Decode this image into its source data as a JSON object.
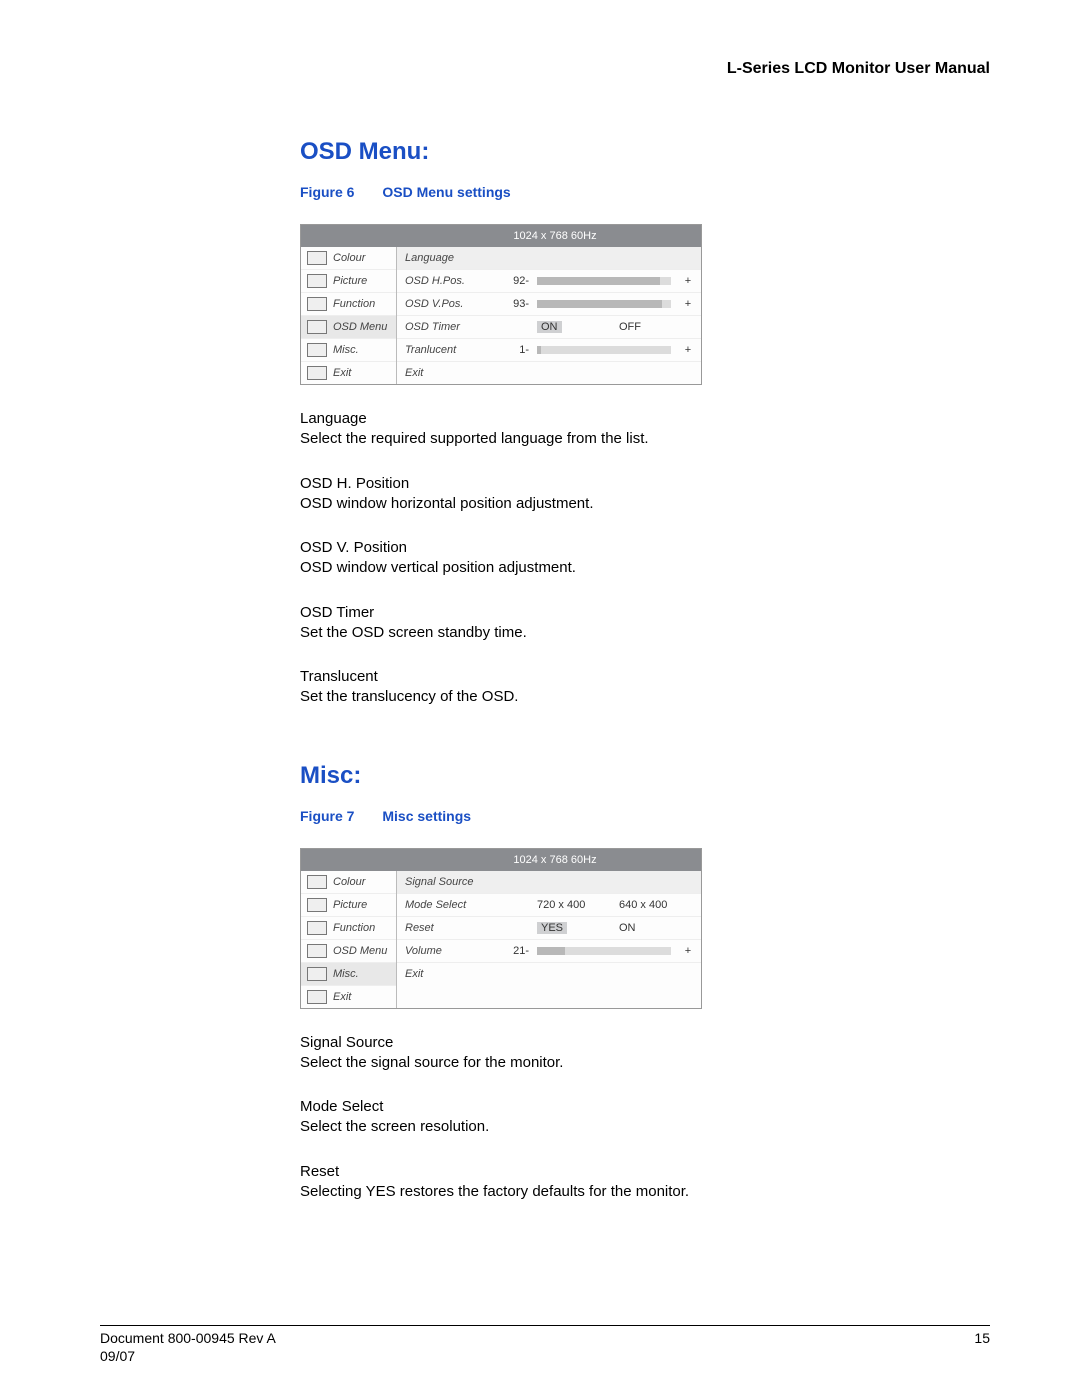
{
  "running_header": "L-Series LCD Monitor User Manual",
  "section1": {
    "title": "OSD Menu:",
    "figure_label": "Figure 6",
    "figure_caption": "OSD Menu settings",
    "osd": {
      "resolution": "1024  x  768  60Hz",
      "nav": [
        {
          "label": "Colour"
        },
        {
          "label": "Picture"
        },
        {
          "label": "Function"
        },
        {
          "label": "OSD Menu",
          "selected": true
        },
        {
          "label": "Misc."
        },
        {
          "label": "Exit"
        }
      ],
      "rows": [
        {
          "type": "plain",
          "label": "Language",
          "selected": true
        },
        {
          "type": "slider",
          "label": "OSD H.Pos.",
          "value": "92",
          "fill": 92
        },
        {
          "type": "slider",
          "label": "OSD V.Pos.",
          "value": "93",
          "fill": 93
        },
        {
          "type": "choice",
          "label": "OSD Timer",
          "options": [
            "ON",
            "OFF"
          ],
          "selected_index": 0
        },
        {
          "type": "slider",
          "label": "Tranlucent",
          "value": "1",
          "fill": 3
        },
        {
          "type": "plain",
          "label": "Exit"
        }
      ]
    },
    "paras": [
      {
        "term": "Language",
        "desc": "Select the required supported language from the list."
      },
      {
        "term": "OSD H. Position",
        "desc": "OSD window horizontal position adjustment."
      },
      {
        "term": "OSD V. Position",
        "desc": "OSD window vertical position adjustment."
      },
      {
        "term": "OSD Timer",
        "desc": "Set the OSD screen standby time."
      },
      {
        "term": "Translucent",
        "desc": "Set the translucency of the OSD."
      }
    ]
  },
  "section2": {
    "title": "Misc:",
    "figure_label": "Figure 7",
    "figure_caption": "Misc settings",
    "osd": {
      "resolution": "1024  x  768  60Hz",
      "nav": [
        {
          "label": "Colour"
        },
        {
          "label": "Picture"
        },
        {
          "label": "Function"
        },
        {
          "label": "OSD Menu"
        },
        {
          "label": "Misc.",
          "selected": true
        },
        {
          "label": "Exit"
        }
      ],
      "rows": [
        {
          "type": "plain",
          "label": "Signal Source",
          "selected": true
        },
        {
          "type": "choice",
          "label": "Mode Select",
          "options": [
            "720 x 400",
            "640 x 400"
          ],
          "selected_index": -1
        },
        {
          "type": "choice",
          "label": "Reset",
          "options": [
            "YES",
            "ON"
          ],
          "selected_index": 0
        },
        {
          "type": "slider",
          "label": "Volume",
          "value": "21",
          "fill": 21
        },
        {
          "type": "plain",
          "label": "Exit"
        }
      ]
    },
    "paras": [
      {
        "term": "Signal Source",
        "desc": "Select the signal source for the monitor."
      },
      {
        "term": "Mode Select",
        "desc": "Select the screen resolution."
      },
      {
        "term": "Reset",
        "desc": "Selecting YES restores the factory defaults for the monitor."
      }
    ]
  },
  "footer": {
    "doc": "Document 800-00945 Rev A",
    "date": "09/07",
    "page": "15"
  }
}
